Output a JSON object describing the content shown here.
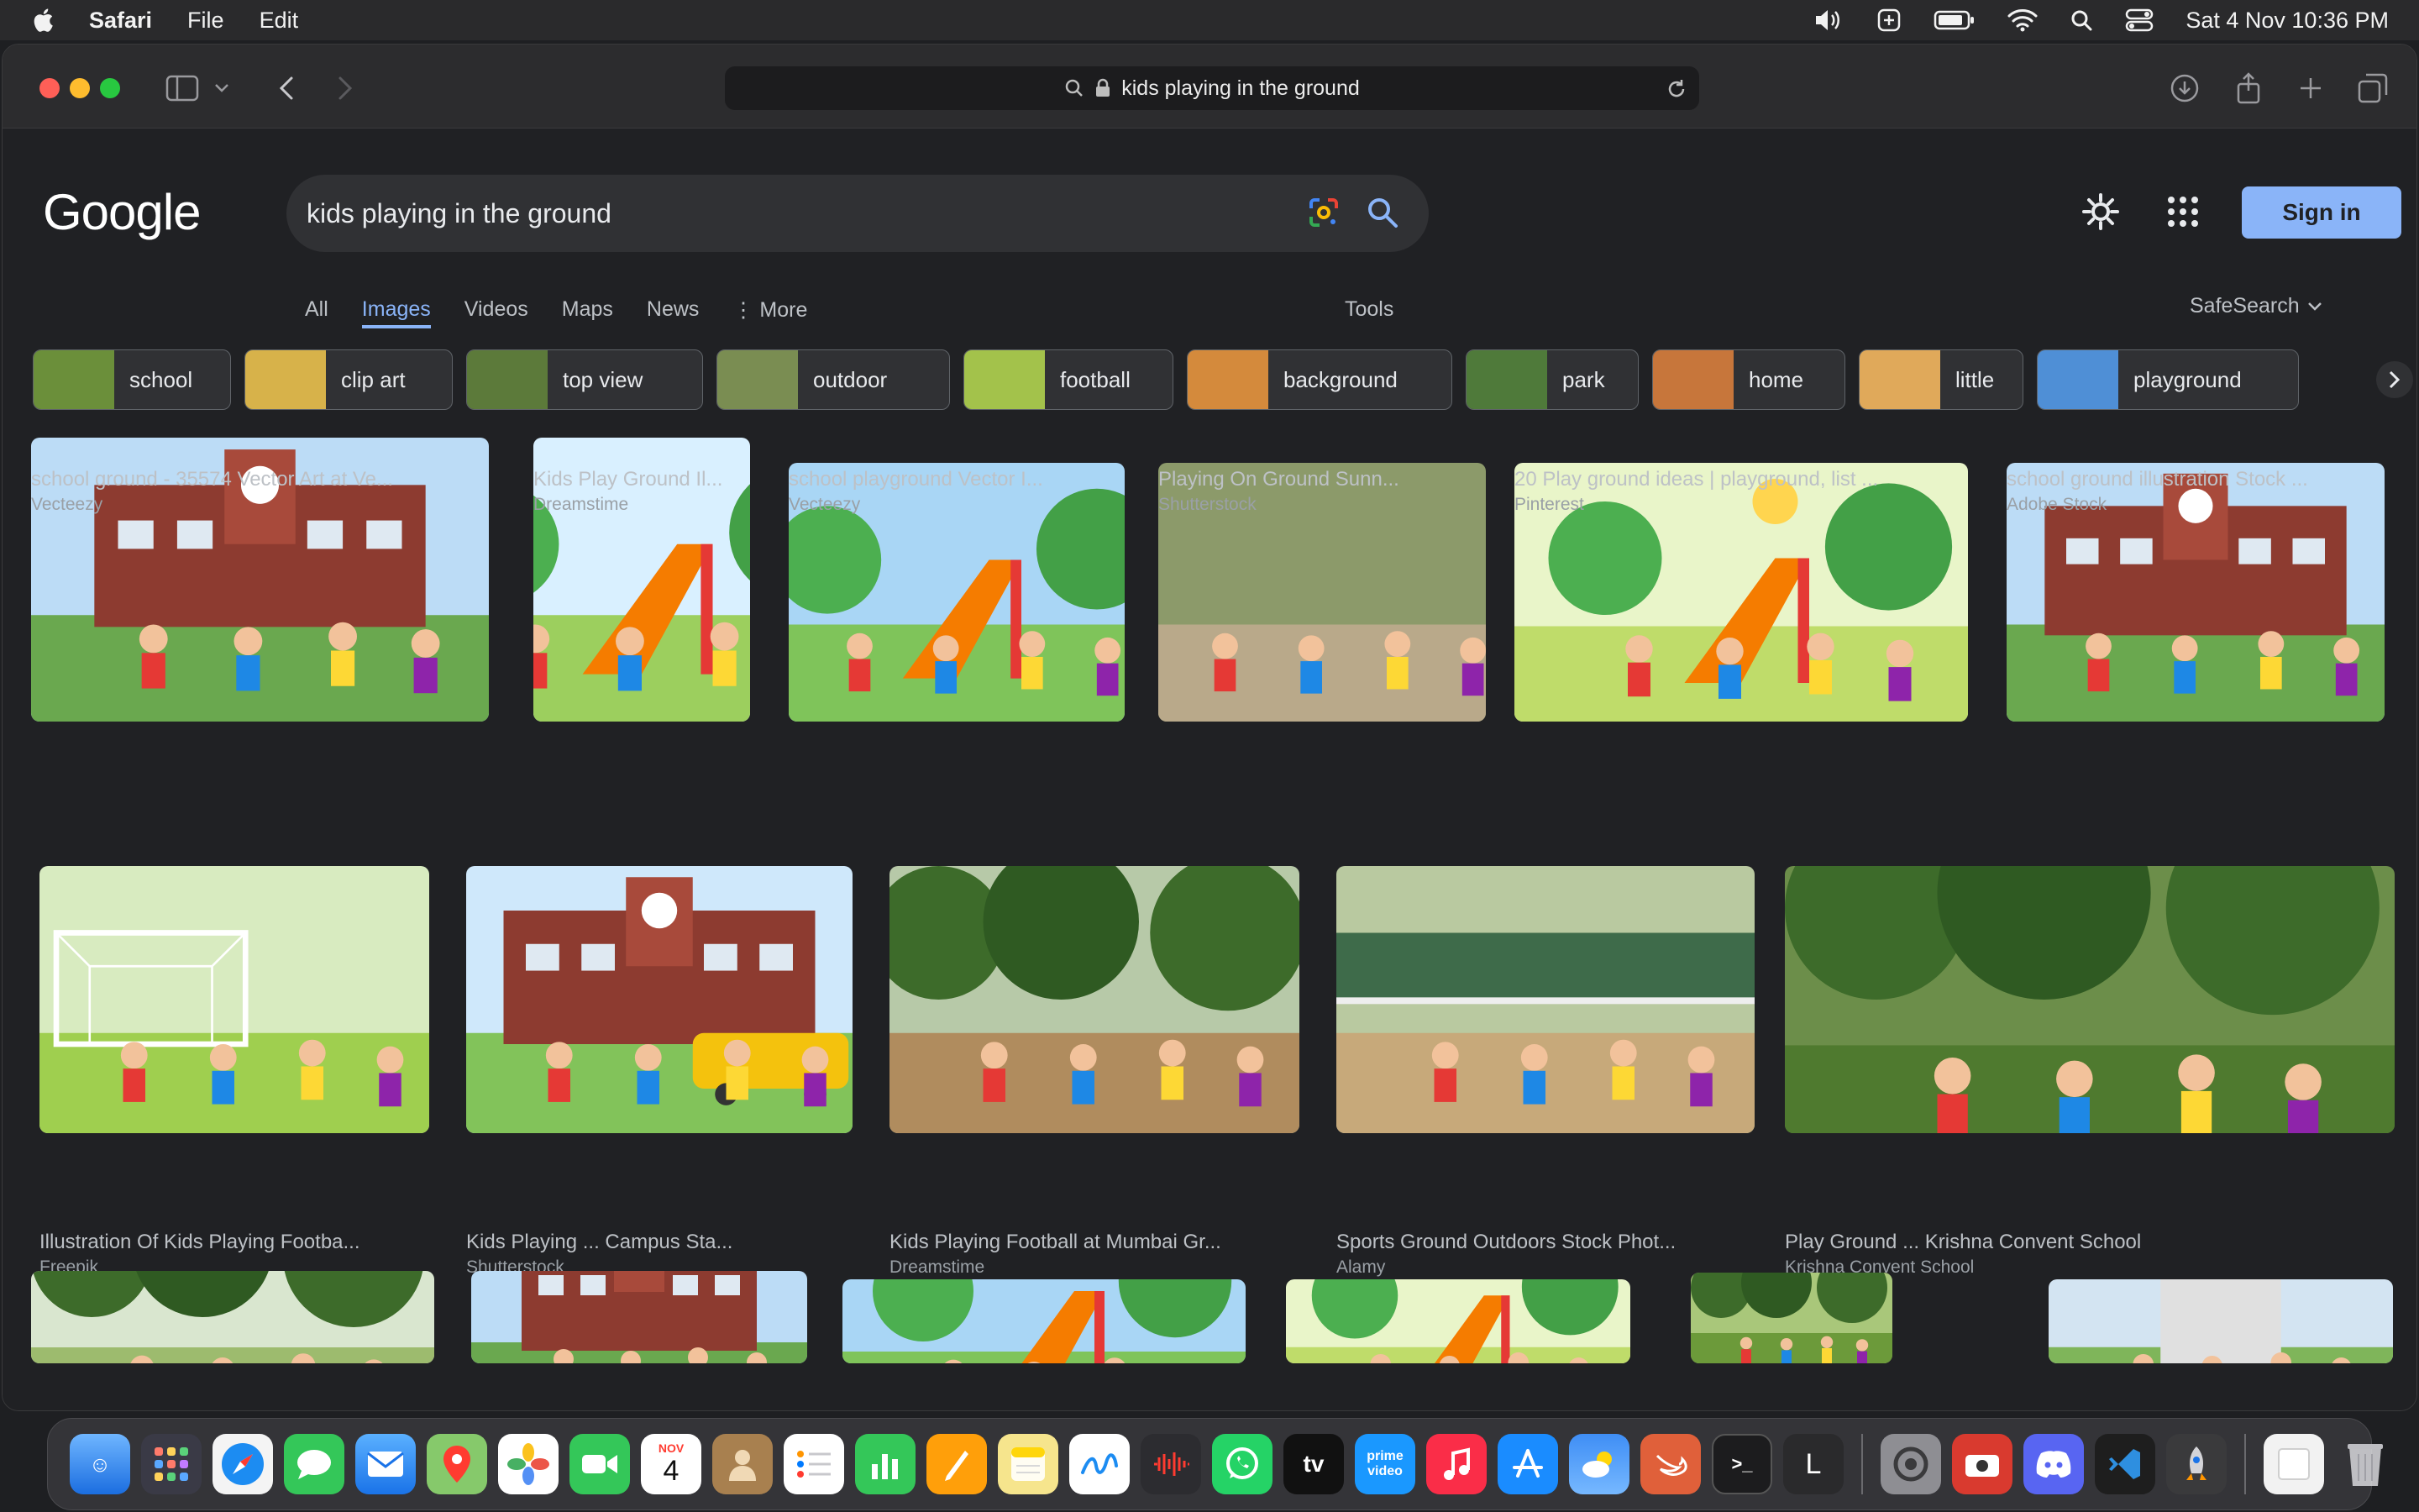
{
  "menubar": {
    "app_name": "Safari",
    "menus": [
      "File",
      "Edit"
    ],
    "clock": "Sat 4 Nov  10:36 PM"
  },
  "browser": {
    "address": "kids playing in the ground"
  },
  "google": {
    "logo": "Google",
    "query": "kids playing in the ground",
    "signin_label": "Sign in",
    "tabs": [
      "All",
      "Images",
      "Videos",
      "Maps",
      "News",
      "More"
    ],
    "active_tab": "Images",
    "tools_label": "Tools",
    "safesearch_label": "SafeSearch"
  },
  "chips": [
    {
      "label": "school",
      "color": "#6b8f3a"
    },
    {
      "label": "clip art",
      "color": "#d7b24a"
    },
    {
      "label": "top view",
      "color": "#5c7a3a"
    },
    {
      "label": "outdoor",
      "color": "#7a8d52"
    },
    {
      "label": "football",
      "color": "#a3c24b"
    },
    {
      "label": "background",
      "color": "#d48a3c"
    },
    {
      "label": "park",
      "color": "#4f7a3a"
    },
    {
      "label": "home",
      "color": "#c7763b"
    },
    {
      "label": "little",
      "color": "#e0a95a"
    },
    {
      "label": "playground",
      "color": "#4f8fd6"
    }
  ],
  "results": [
    {
      "caption": "school ground - 35574 Vector Art at Ve...",
      "source": "Vecteezy",
      "scene": "school"
    },
    {
      "caption": "Kids Play Ground Il...",
      "source": "Dreamstime",
      "scene": "swing"
    },
    {
      "caption": "school playground Vector I...",
      "source": "Vecteezy",
      "scene": "slide"
    },
    {
      "caption": "Playing On Ground Sunn...",
      "source": "Shutterstock",
      "scene": "photo-kids"
    },
    {
      "caption": "20 Play ground ideas | playground, list ...",
      "source": "Pinterest",
      "scene": "park"
    },
    {
      "caption": "school ground illustration Stock ...",
      "source": "Adobe Stock",
      "scene": "school"
    },
    {
      "caption": "Illustration Of Kids Playing Footba...",
      "source": "Freepik",
      "scene": "football"
    },
    {
      "caption": "Kids Playing ... Campus Sta...",
      "source": "Shutterstock",
      "scene": "school-bus"
    },
    {
      "caption": "Kids Playing Football at Mumbai Gr...",
      "source": "Dreamstime",
      "scene": "photo-field"
    },
    {
      "caption": "Sports Ground Outdoors Stock Phot...",
      "source": "Alamy",
      "scene": "photo-court"
    },
    {
      "caption": "Play Ground ... Krishna Convent School",
      "source": "Krishna Convent School",
      "scene": "photo-grass"
    },
    {
      "caption": "",
      "source": "",
      "scene": "cartoon"
    },
    {
      "caption": "",
      "source": "",
      "scene": "school"
    },
    {
      "caption": "",
      "source": "",
      "scene": "slide"
    },
    {
      "caption": "",
      "source": "",
      "scene": "park"
    },
    {
      "caption": "",
      "source": "",
      "scene": "tree"
    },
    {
      "caption": "",
      "source": "",
      "scene": "house"
    }
  ],
  "dock": {
    "calendar_month": "NOV",
    "calendar_day": "4",
    "tv_label": "tv",
    "prime_label": "prime video",
    "terminal_label": ">_",
    "l_label": "L"
  },
  "colors": {
    "accent": "#8ab4f8",
    "page_bg": "#202124",
    "toolbar_bg": "#2c2c2e"
  }
}
